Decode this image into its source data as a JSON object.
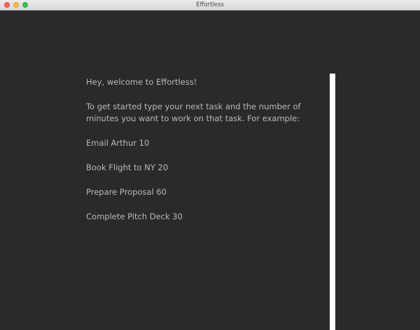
{
  "window": {
    "title": "Effortless"
  },
  "editor": {
    "welcome": "Hey, welcome to Effortless!",
    "instructions": "To get started type your next task and the number of minutes you want to work on that task. For example:",
    "examples": [
      "Email Arthur 10",
      "Book Flight to NY 20",
      "Prepare Proposal 60",
      "Complete Pitch Deck 30"
    ]
  },
  "colors": {
    "background": "#2a2a2a",
    "text": "#b9b9b9",
    "scrollbar": "#ffffff"
  }
}
